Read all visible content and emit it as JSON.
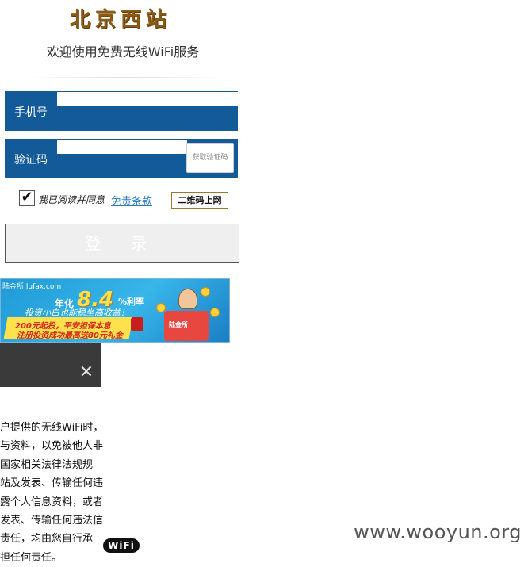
{
  "brand": {
    "logo_text": "北京西站"
  },
  "welcome": "欢迎使用免费无线WiFi服务",
  "form": {
    "phone_label": "手机号",
    "phone_value": "",
    "code_label": "验证码",
    "code_value": "",
    "get_code_label": "获取验证码",
    "agree_checked": true,
    "agree_text": "我已阅读并同意",
    "disclaimer_link": "免责条款",
    "qr_login_label": "二维码上网",
    "login_label": "登 录"
  },
  "ad": {
    "brand": "陆金所 lufax.com",
    "rate_prefix": "年化",
    "rate": "8.4",
    "rate_unit": "%利率",
    "line1": "投资小白也能稳坐高收益！",
    "line2": "200元起投，平安担保本息",
    "line3": "注册投资成功最高送80元礼金",
    "box_label": "陆金所"
  },
  "notice_lines": [
    "户提供的无线WiFi时，",
    "与资料，以免被他人非",
    "国家相关法律法规规",
    "站及发表、传输任何违",
    "露个人信息资料，或者",
    "发表、传输任何违法信",
    "责任，均由您自行承",
    "担任何责任。"
  ],
  "wifi_badge": "WiFi",
  "watermark": "www.wooyun.org",
  "icons": {
    "close": "close-icon",
    "checkbox": "checkmark-icon",
    "wifi": "wifi-logo-icon"
  },
  "colors": {
    "field_bg": "#125a98",
    "logo": "#8a5a16",
    "link": "#2a7ac0"
  }
}
